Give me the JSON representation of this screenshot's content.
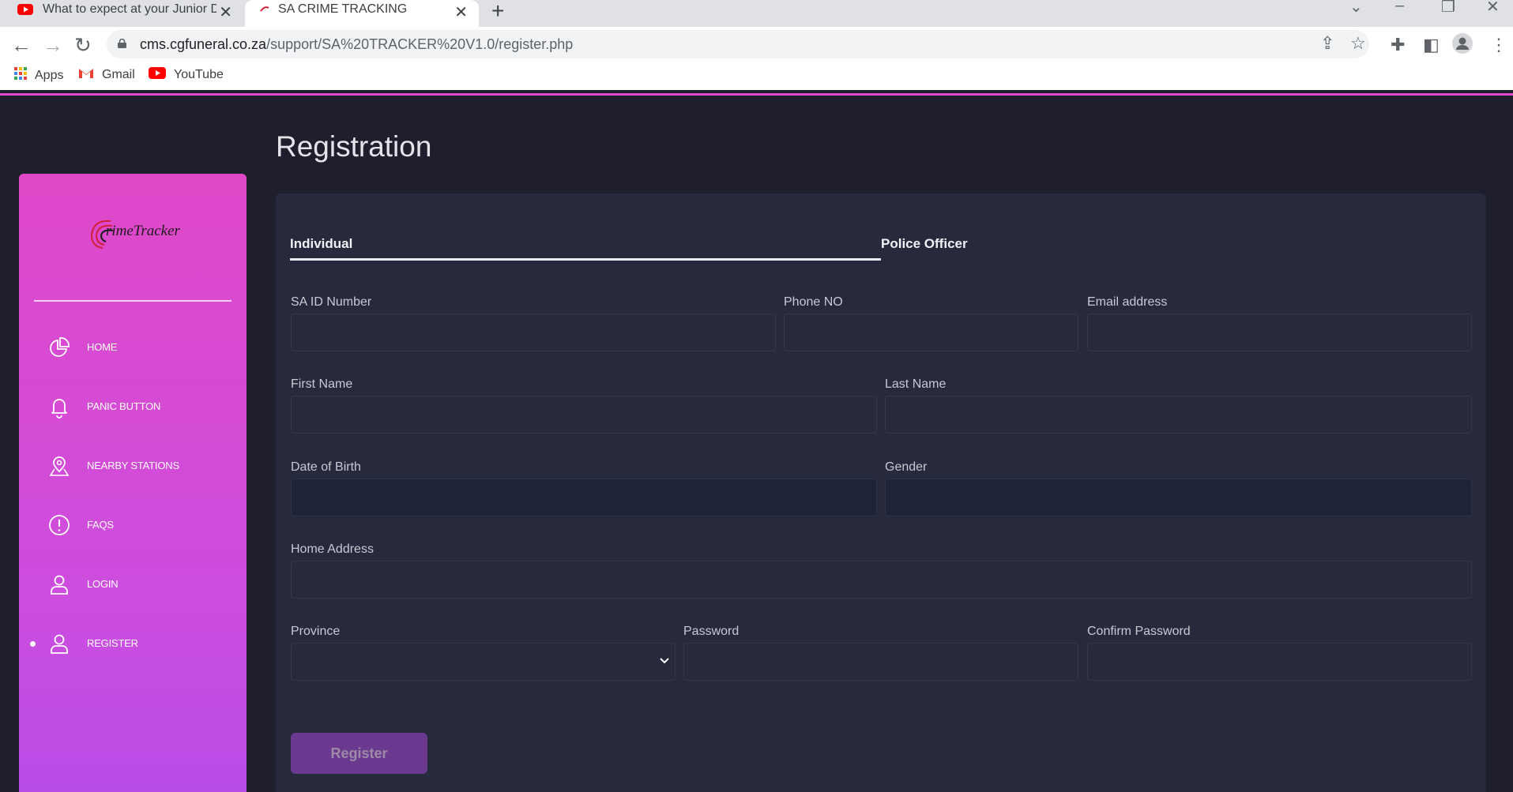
{
  "browser": {
    "tabs": [
      {
        "title": "What to expect at your Junior De",
        "favicon": "youtube-icon",
        "active": false
      },
      {
        "title": "SA CRIME TRACKING",
        "favicon": "crimetracker-favicon",
        "active": true
      }
    ],
    "url_host": "cms.cgfuneral.co.za",
    "url_path": "/support/SA%20TRACKER%20V1.0/register.php",
    "bookmarks": [
      {
        "label": "Apps",
        "icon": "apps-grid-icon"
      },
      {
        "label": "Gmail",
        "icon": "gmail-icon"
      },
      {
        "label": "YouTube",
        "icon": "youtube-icon"
      }
    ]
  },
  "sidebar": {
    "logo_text": "rimeTracker",
    "items": [
      {
        "label": "HOME",
        "icon": "pie-chart-icon",
        "active": false
      },
      {
        "label": "PANIC BUTTON",
        "icon": "bell-icon",
        "active": false
      },
      {
        "label": "NEARBY STATIONS",
        "icon": "map-pin-icon",
        "active": false
      },
      {
        "label": "FAQS",
        "icon": "alert-circle-icon",
        "active": false
      },
      {
        "label": "LOGIN",
        "icon": "user-icon",
        "active": false
      },
      {
        "label": "REGISTER",
        "icon": "user-icon",
        "active": true
      }
    ]
  },
  "page": {
    "title": "Registration",
    "tabs": {
      "individual": "Individual",
      "police": "Police Officer"
    },
    "fields": {
      "id_number": {
        "label": "SA ID Number",
        "value": ""
      },
      "phone": {
        "label": "Phone NO",
        "value": ""
      },
      "email": {
        "label": "Email address",
        "value": ""
      },
      "first_name": {
        "label": "First Name",
        "value": ""
      },
      "last_name": {
        "label": "Last Name",
        "value": ""
      },
      "dob": {
        "label": "Date of Birth",
        "value": ""
      },
      "gender": {
        "label": "Gender",
        "value": ""
      },
      "address": {
        "label": "Home Address",
        "value": ""
      },
      "province": {
        "label": "Province",
        "value": ""
      },
      "password": {
        "label": "Password",
        "value": ""
      },
      "confirm_password": {
        "label": "Confirm Password",
        "value": ""
      }
    },
    "register_button": "Register"
  },
  "colors": {
    "page_bg": "#1e1e2c",
    "card_bg": "#262a3c",
    "sidebar_top": "#e048c8",
    "sidebar_bottom": "#b84ce6",
    "button_bg": "#6b3a90"
  }
}
